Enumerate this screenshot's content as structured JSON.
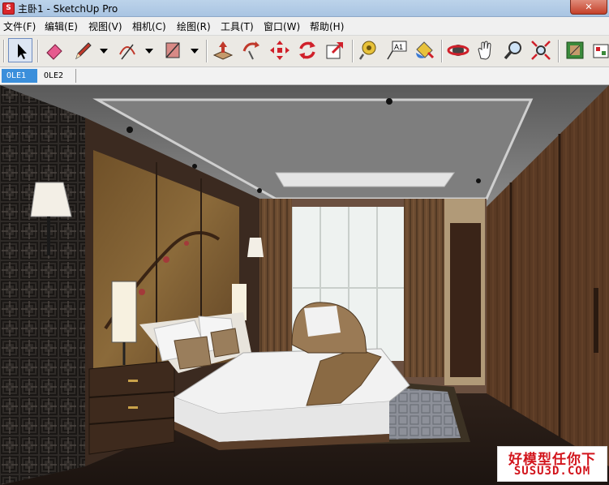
{
  "window": {
    "title": "主卧1 - SketchUp Pro",
    "app_icon": "sketchup-logo-icon",
    "close_label": "✕"
  },
  "menu": [
    "文件(F)",
    "编辑(E)",
    "视图(V)",
    "相机(C)",
    "绘图(R)",
    "工具(T)",
    "窗口(W)",
    "帮助(H)"
  ],
  "toolbar": {
    "tools": [
      {
        "name": "select-tool-icon"
      },
      {
        "name": "eraser-icon"
      },
      {
        "name": "pencil-icon"
      },
      {
        "name": "arc-icon"
      },
      {
        "name": "rectangle-icon"
      },
      {
        "name": "push-pull-icon"
      },
      {
        "name": "follow-me-icon"
      },
      {
        "name": "move-icon"
      },
      {
        "name": "rotate-icon"
      },
      {
        "name": "scale-icon"
      },
      {
        "name": "tape-measure-icon"
      },
      {
        "name": "text-icon"
      },
      {
        "name": "paint-bucket-icon"
      },
      {
        "name": "orbit-icon"
      },
      {
        "name": "pan-icon"
      },
      {
        "name": "zoom-icon"
      },
      {
        "name": "zoom-extents-icon"
      },
      {
        "name": "component-icon"
      },
      {
        "name": "warehouse-icon"
      }
    ],
    "text_tool_label": "A1"
  },
  "scenes": {
    "tabs": [
      "OLE1",
      "OLE2"
    ],
    "active": "OLE1"
  },
  "viewport": {
    "description_icon": "3d-bedroom-model"
  },
  "watermark": {
    "line1": "好模型任你下",
    "line2": "SUSU3D.COM"
  }
}
